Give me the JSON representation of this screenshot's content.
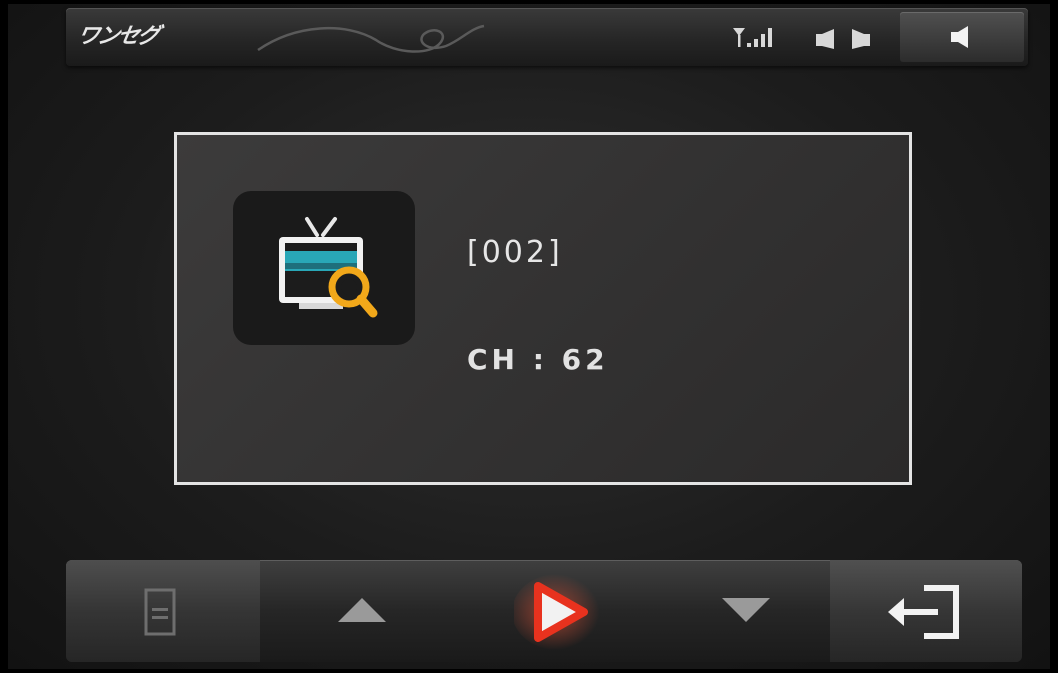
{
  "app": {
    "logo_text": "ワンセグ"
  },
  "status_bar": {
    "icons": [
      "swirl-decoration",
      "signal-strength-icon",
      "sound-mode-icon",
      "volume-icon"
    ]
  },
  "channel_panel": {
    "icon": "tv-search-icon",
    "channel_id": "[002]",
    "channel_text": "CH : 62"
  },
  "control_bar": {
    "buttons": [
      {
        "name": "menu-button",
        "icon": "menu-panel-icon"
      },
      {
        "name": "channel-up-button",
        "icon": "triangle-up-icon"
      },
      {
        "name": "play-button",
        "icon": "play-icon"
      },
      {
        "name": "channel-down-button",
        "icon": "triangle-down-icon"
      },
      {
        "name": "exit-button",
        "icon": "exit-icon"
      }
    ]
  },
  "colors": {
    "play_accent": "#e8321e",
    "search_accent": "#f2a81a",
    "tv_screen": "#2bb7c9"
  }
}
